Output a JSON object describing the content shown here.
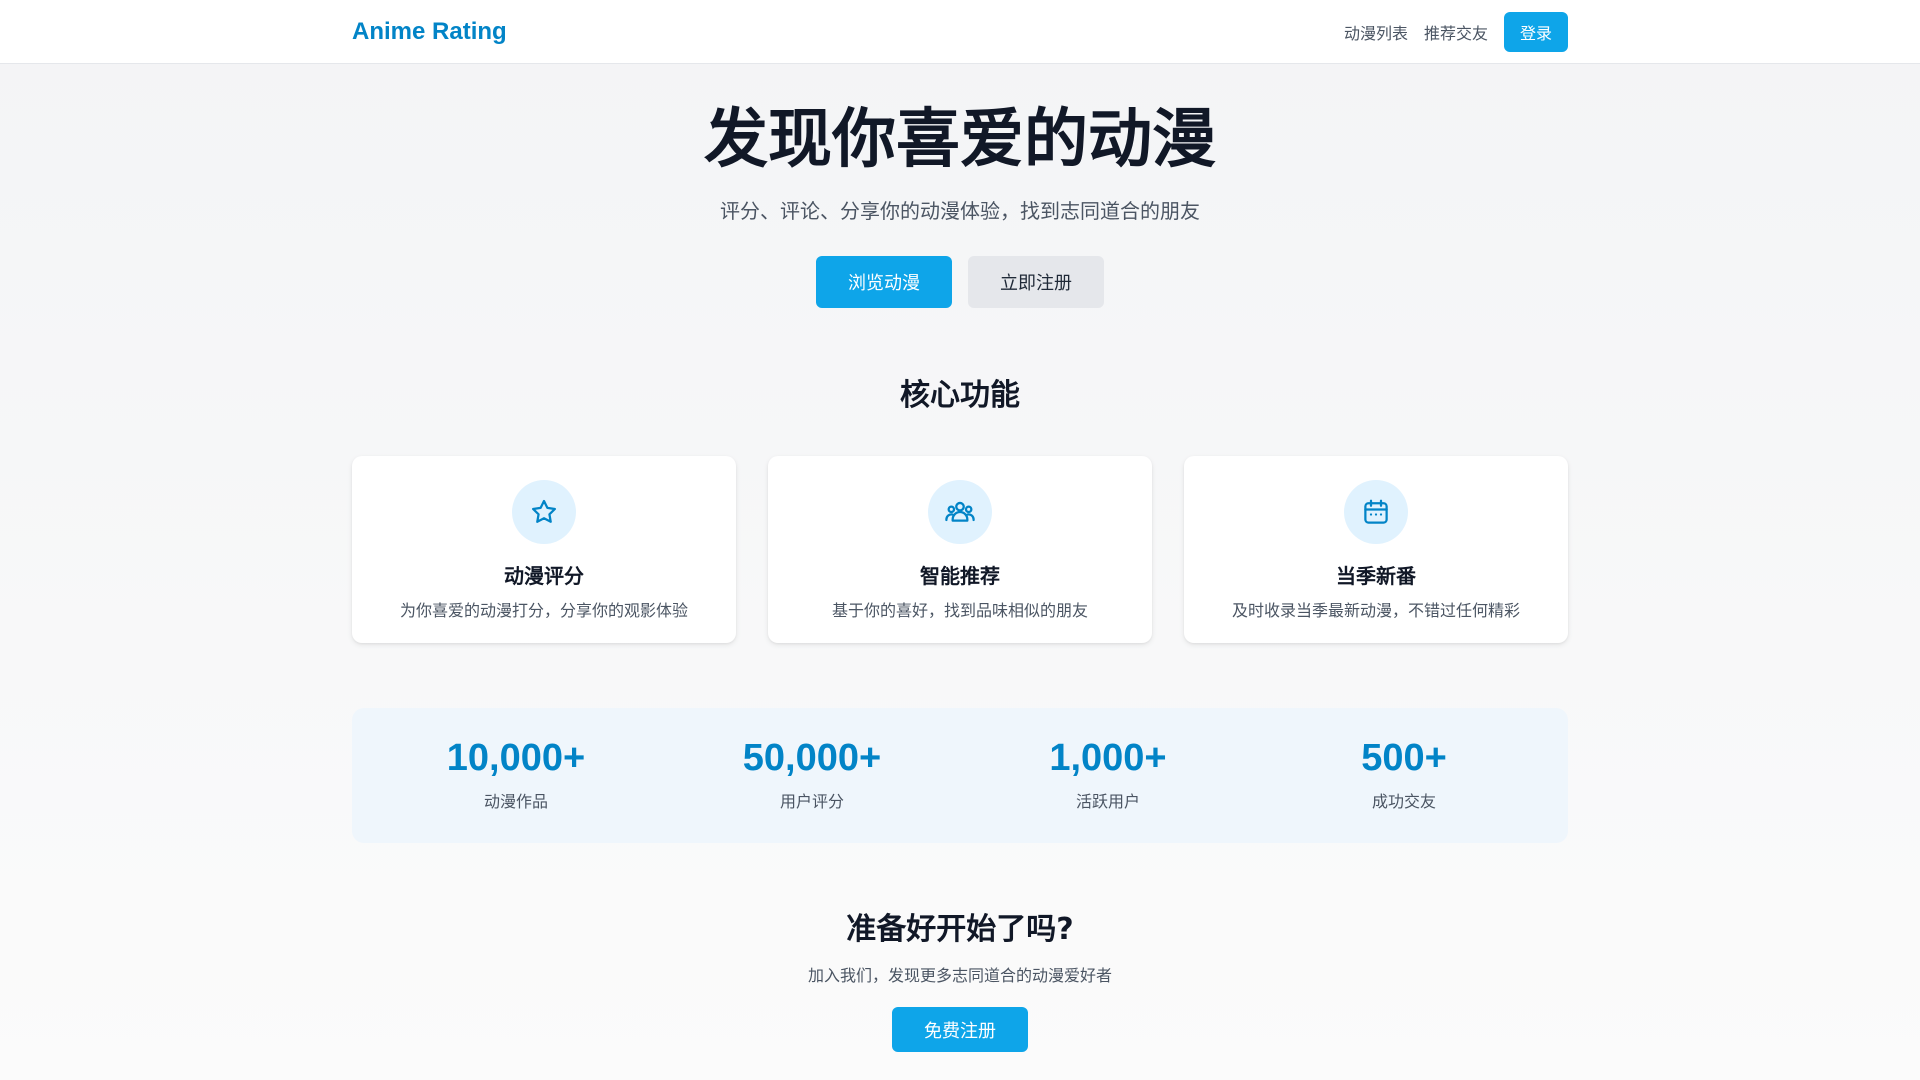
{
  "nav": {
    "brand": "Anime Rating",
    "links": [
      "动漫列表",
      "推荐交友"
    ],
    "login_label": "登录"
  },
  "hero": {
    "title": "发现你喜爱的动漫",
    "subtitle": "评分、评论、分享你的动漫体验，找到志同道合的朋友",
    "primary_label": "浏览动漫",
    "secondary_label": "立即注册"
  },
  "features": {
    "title": "核心功能",
    "cards": [
      {
        "icon": "star-icon",
        "title": "动漫评分",
        "desc": "为你喜爱的动漫打分，分享你的观影体验"
      },
      {
        "icon": "users-icon",
        "title": "智能推荐",
        "desc": "基于你的喜好，找到品味相似的朋友"
      },
      {
        "icon": "calendar-icon",
        "title": "当季新番",
        "desc": "及时收录当季最新动漫，不错过任何精彩"
      }
    ]
  },
  "stats": [
    {
      "value": "10,000+",
      "label": "动漫作品"
    },
    {
      "value": "50,000+",
      "label": "用户评分"
    },
    {
      "value": "1,000+",
      "label": "活跃用户"
    },
    {
      "value": "500+",
      "label": "成功交友"
    }
  ],
  "cta": {
    "title": "准备好开始了吗?",
    "subtitle": "加入我们，发现更多志同道合的动漫爱好者",
    "button_label": "免费注册"
  },
  "colors": {
    "accent": "#0ea5e9",
    "brand": "#0284c7",
    "icon_bg": "#e0f2fe",
    "stats_bg": "#eff6fc"
  }
}
